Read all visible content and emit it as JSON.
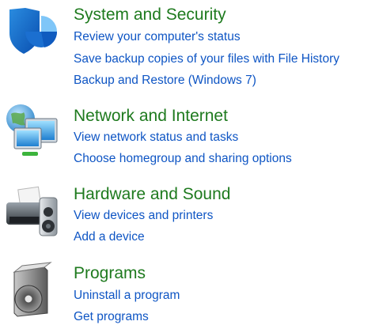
{
  "categories": [
    {
      "title": "System and Security",
      "icon": "shield-icon",
      "links": [
        "Review your computer's status",
        "Save backup copies of your files with File History",
        "Backup and Restore (Windows 7)"
      ]
    },
    {
      "title": "Network and Internet",
      "icon": "network-icon",
      "links": [
        "View network status and tasks",
        "Choose homegroup and sharing options"
      ]
    },
    {
      "title": "Hardware and Sound",
      "icon": "printer-icon",
      "links": [
        "View devices and printers",
        "Add a device"
      ]
    },
    {
      "title": "Programs",
      "icon": "programs-icon",
      "links": [
        "Uninstall a program",
        "Get programs"
      ]
    }
  ],
  "colors": {
    "title": "#1e7a1e",
    "link": "#0e55c4",
    "background": "#ffffff"
  }
}
